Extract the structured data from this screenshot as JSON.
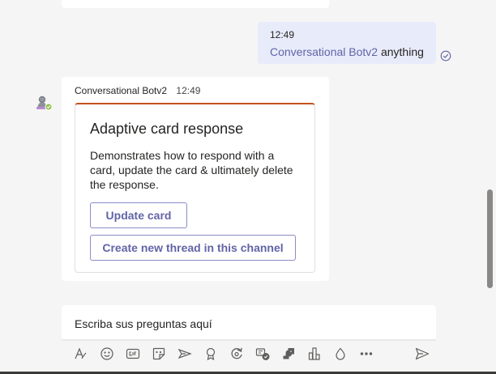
{
  "outgoing": {
    "time": "12:49",
    "mention": "Conversational Botv2",
    "text": "anything"
  },
  "incoming": {
    "sender": "Conversational Botv2",
    "time": "12:49",
    "card": {
      "title": "Adaptive card response",
      "description": "Demonstrates how to respond with a card, update the card & ultimately delete the response.",
      "buttons": {
        "update": "Update card",
        "new_thread": "Create new thread in this channel"
      },
      "accent_color": "#c4511c"
    }
  },
  "compose": {
    "placeholder": "Escriba sus preguntas aquí"
  },
  "toolbar": {
    "icons": [
      "format-icon",
      "emoji-icon",
      "gif-icon",
      "sticker-icon",
      "meet-now-icon",
      "praise-icon",
      "loop-icon",
      "approvals-icon",
      "apps-icon",
      "polls-icon",
      "updates-icon",
      "more-options-icon",
      "send-icon"
    ]
  },
  "colors": {
    "brand": "#6264a7",
    "outgoing_bubble": "#e8ebfa",
    "status_available": "#92c353"
  }
}
